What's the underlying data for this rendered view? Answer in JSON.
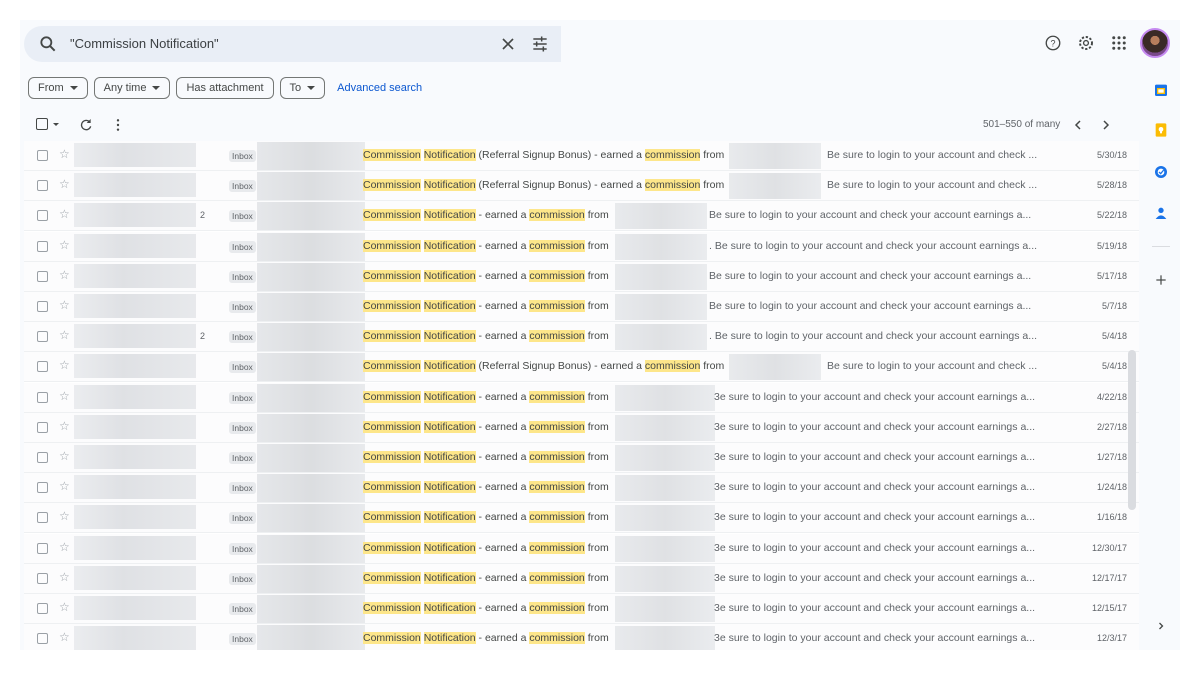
{
  "search": {
    "query": "\"Commission Notification\""
  },
  "filters": {
    "chips": [
      "From",
      "Any time",
      "Has attachment",
      "To"
    ],
    "advanced_link": "Advanced search"
  },
  "toolbar": {
    "pagination": "501–550 of many"
  },
  "emails": [
    {
      "count": "",
      "label": "Inbox",
      "subject_parts": [
        [
          "Commission",
          true
        ],
        [
          " ",
          false
        ],
        [
          "Notification",
          true
        ],
        [
          " (Referral Signup Bonus) - earned a ",
          false
        ],
        [
          "commission",
          true
        ],
        [
          " from",
          false
        ]
      ],
      "snippet": "Be sure to login to your account and check ...",
      "date": "5/30/18",
      "variant": "referral"
    },
    {
      "count": "",
      "label": "Inbox",
      "subject_parts": [
        [
          "Commission",
          true
        ],
        [
          " ",
          false
        ],
        [
          "Notification",
          true
        ],
        [
          " (Referral Signup Bonus) - earned a ",
          false
        ],
        [
          "commission",
          true
        ],
        [
          " from",
          false
        ]
      ],
      "snippet": "Be sure to login to your account and check ...",
      "date": "5/28/18",
      "variant": "referral"
    },
    {
      "count": "2",
      "label": "Inbox",
      "subject_parts": [
        [
          "Commission",
          true
        ],
        [
          " ",
          false
        ],
        [
          "Notification",
          true
        ],
        [
          " - earned a ",
          false
        ],
        [
          "commission",
          true
        ],
        [
          " from",
          false
        ]
      ],
      "snippet": "Be sure to login to your account and check your account earnings a...",
      "date": "5/22/18",
      "variant": "normal"
    },
    {
      "count": "",
      "label": "Inbox",
      "subject_parts": [
        [
          "Commission",
          true
        ],
        [
          " ",
          false
        ],
        [
          "Notification",
          true
        ],
        [
          " - earned a ",
          false
        ],
        [
          "commission",
          true
        ],
        [
          " from",
          false
        ]
      ],
      "snippet": ". Be sure to login to your account and check your account earnings a...",
      "date": "5/19/18",
      "variant": "normal"
    },
    {
      "count": "",
      "label": "Inbox",
      "subject_parts": [
        [
          "Commission",
          true
        ],
        [
          " ",
          false
        ],
        [
          "Notification",
          true
        ],
        [
          " - earned a ",
          false
        ],
        [
          "commission",
          true
        ],
        [
          " from",
          false
        ]
      ],
      "snippet": "Be sure to login to your account and check your account earnings a...",
      "date": "5/17/18",
      "variant": "normal"
    },
    {
      "count": "",
      "label": "Inbox",
      "subject_parts": [
        [
          "Commission",
          true
        ],
        [
          " ",
          false
        ],
        [
          "Notification",
          true
        ],
        [
          " - earned a ",
          false
        ],
        [
          "commission",
          true
        ],
        [
          " from",
          false
        ]
      ],
      "snippet": "Be sure to login to your account and check your account earnings a...",
      "date": "5/7/18",
      "variant": "normal"
    },
    {
      "count": "2",
      "label": "Inbox",
      "subject_parts": [
        [
          "Commission",
          true
        ],
        [
          " ",
          false
        ],
        [
          "Notification",
          true
        ],
        [
          " - earned a ",
          false
        ],
        [
          "commission",
          true
        ],
        [
          " from",
          false
        ]
      ],
      "snippet": ". Be sure to login to your account and check your account earnings a...",
      "date": "5/4/18",
      "variant": "normal"
    },
    {
      "count": "",
      "label": "Inbox",
      "subject_parts": [
        [
          "Commission",
          true
        ],
        [
          " ",
          false
        ],
        [
          "Notification",
          true
        ],
        [
          " (Referral Signup Bonus) - earned a ",
          false
        ],
        [
          "commission",
          true
        ],
        [
          " from",
          false
        ]
      ],
      "snippet": "Be sure to login to your account and check ...",
      "date": "5/4/18",
      "variant": "referral"
    },
    {
      "count": "",
      "label": "Inbox",
      "subject_parts": [
        [
          "Commission",
          true
        ],
        [
          " ",
          false
        ],
        [
          "Notification",
          true
        ],
        [
          " - earned a ",
          false
        ],
        [
          "commission",
          true
        ],
        [
          " from",
          false
        ]
      ],
      "snippet": "3e sure to login to your account and check your account earnings a...",
      "date": "4/22/18",
      "variant": "wide"
    },
    {
      "count": "",
      "label": "Inbox",
      "subject_parts": [
        [
          "Commission",
          true
        ],
        [
          " ",
          false
        ],
        [
          "Notification",
          true
        ],
        [
          " - earned a ",
          false
        ],
        [
          "commission",
          true
        ],
        [
          " from",
          false
        ]
      ],
      "snippet": "3e sure to login to your account and check your account earnings a...",
      "date": "2/27/18",
      "variant": "wide"
    },
    {
      "count": "",
      "label": "Inbox",
      "subject_parts": [
        [
          "Commission",
          true
        ],
        [
          " ",
          false
        ],
        [
          "Notification",
          true
        ],
        [
          " - earned a ",
          false
        ],
        [
          "commission",
          true
        ],
        [
          " from",
          false
        ]
      ],
      "snippet": "3e sure to login to your account and check your account earnings a...",
      "date": "1/27/18",
      "variant": "wide"
    },
    {
      "count": "",
      "label": "Inbox",
      "subject_parts": [
        [
          "Commission",
          true
        ],
        [
          " ",
          false
        ],
        [
          "Notification",
          true
        ],
        [
          " - earned a ",
          false
        ],
        [
          "commission",
          true
        ],
        [
          " from",
          false
        ]
      ],
      "snippet": "3e sure to login to your account and check your account earnings a...",
      "date": "1/24/18",
      "variant": "wide"
    },
    {
      "count": "",
      "label": "Inbox",
      "subject_parts": [
        [
          "Commission",
          true
        ],
        [
          " ",
          false
        ],
        [
          "Notification",
          true
        ],
        [
          " - earned a ",
          false
        ],
        [
          "commission",
          true
        ],
        [
          " from",
          false
        ]
      ],
      "snippet": "3e sure to login to your account and check your account earnings a...",
      "date": "1/16/18",
      "variant": "wide"
    },
    {
      "count": "",
      "label": "Inbox",
      "subject_parts": [
        [
          "Commission",
          true
        ],
        [
          " ",
          false
        ],
        [
          "Notification",
          true
        ],
        [
          " - earned a ",
          false
        ],
        [
          "commission",
          true
        ],
        [
          " from",
          false
        ]
      ],
      "snippet": "3e sure to login to your account and check your account earnings a...",
      "date": "12/30/17",
      "variant": "wide"
    },
    {
      "count": "",
      "label": "Inbox",
      "subject_parts": [
        [
          "Commission",
          true
        ],
        [
          " ",
          false
        ],
        [
          "Notification",
          true
        ],
        [
          " - earned a ",
          false
        ],
        [
          "commission",
          true
        ],
        [
          " from",
          false
        ]
      ],
      "snippet": "3e sure to login to your account and check your account earnings a...",
      "date": "12/17/17",
      "variant": "wide"
    },
    {
      "count": "",
      "label": "Inbox",
      "subject_parts": [
        [
          "Commission",
          true
        ],
        [
          " ",
          false
        ],
        [
          "Notification",
          true
        ],
        [
          " - earned a ",
          false
        ],
        [
          "commission",
          true
        ],
        [
          " from",
          false
        ]
      ],
      "snippet": "3e sure to login to your account and check your account earnings a...",
      "date": "12/15/17",
      "variant": "wide"
    },
    {
      "count": "",
      "label": "Inbox",
      "subject_parts": [
        [
          "Commission",
          true
        ],
        [
          " ",
          false
        ],
        [
          "Notification",
          true
        ],
        [
          " - earned a ",
          false
        ],
        [
          "commission",
          true
        ],
        [
          " from",
          false
        ]
      ],
      "snippet": "3e sure to login to your account and check your account earnings a...",
      "date": "12/3/17",
      "variant": "wide"
    }
  ],
  "side_panel": [
    {
      "icon": "calendar-icon",
      "color": "#1a73e8"
    },
    {
      "icon": "keep-icon",
      "color": "#fbbc04"
    },
    {
      "icon": "tasks-icon",
      "color": "#1a73e8"
    },
    {
      "icon": "contacts-icon",
      "color": "#1a73e8"
    }
  ],
  "colors": {
    "highlight": "#fde68a",
    "accent": "#0b57d0",
    "background": "#f8fafd"
  }
}
